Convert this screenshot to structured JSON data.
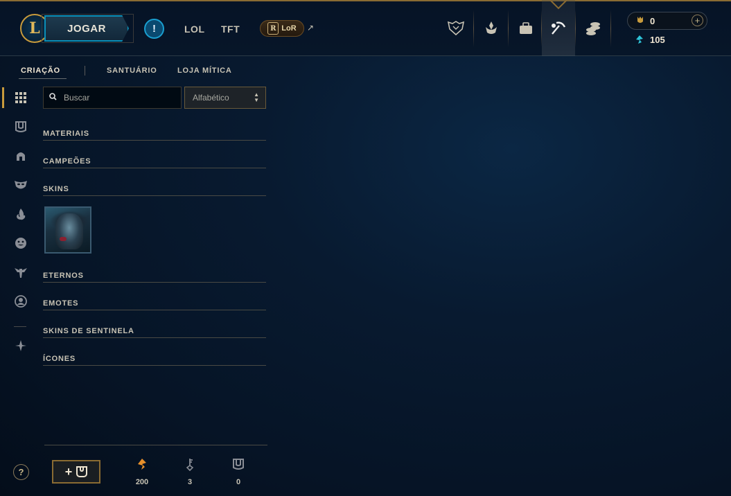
{
  "topbar": {
    "logo_letter": "L",
    "play_label": "JOGAR",
    "alert_label": "!",
    "nav": [
      "LOL",
      "TFT"
    ],
    "lor_label": "LoR",
    "lor_letter": "R",
    "external_glyph": "↗",
    "icons": [
      "clash-icon",
      "ranked-icon",
      "profile-icon",
      "loot-icon",
      "store-icon"
    ],
    "wallet": {
      "rp": "0",
      "be": "105",
      "add_label": "+"
    }
  },
  "subtabs": [
    "CRIAÇÃO",
    "SANTUÁRIO",
    "LOJA MÍTICA"
  ],
  "search": {
    "placeholder": "Buscar"
  },
  "sort": {
    "selected": "Alfabético"
  },
  "categories": [
    "MATERIAIS",
    "CAMPEÕES",
    "SKINS",
    "ETERNOS",
    "EMOTES",
    "SKINS DE SENTINELA",
    "ÍCONES"
  ],
  "footer": {
    "help_label": "?",
    "craft_plus": "+",
    "orange_essence": "200",
    "keys": "3",
    "chests": "0"
  },
  "colors": {
    "gold": "#c89b3c",
    "accent_blue": "#0a8fb8",
    "blue_essence": "#2ec4d8",
    "orange_essence": "#e8902a"
  }
}
